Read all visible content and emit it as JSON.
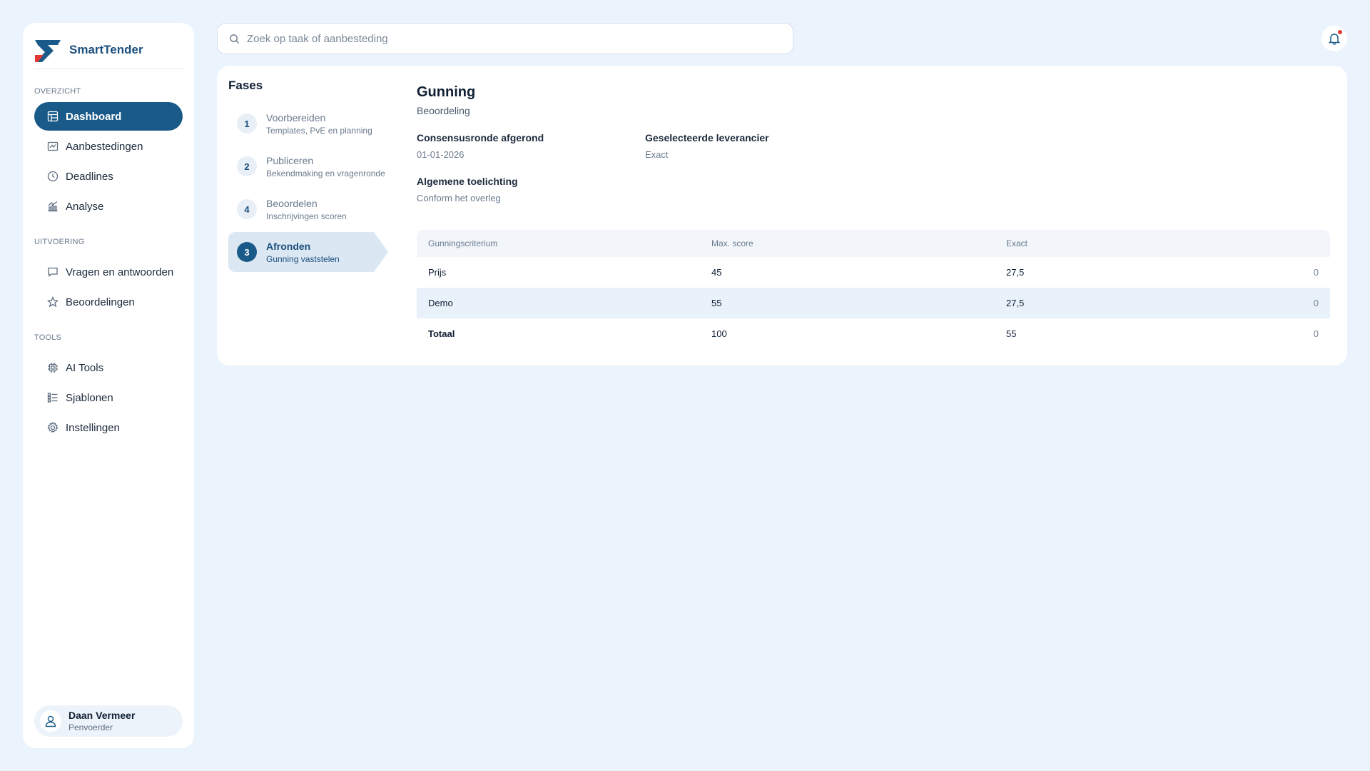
{
  "app": {
    "name": "SmartTender"
  },
  "sidebar": {
    "sections": [
      {
        "label": "OVERZICHT"
      },
      {
        "label": "UITVOERING"
      },
      {
        "label": "TOOLS"
      }
    ],
    "items": [
      {
        "label": "Dashboard",
        "icon": "dashboard-icon",
        "active": true
      },
      {
        "label": "Aanbestedingen",
        "icon": "tenders-icon"
      },
      {
        "label": "Deadlines",
        "icon": "clock-icon"
      },
      {
        "label": "Analyse",
        "icon": "chart-icon"
      },
      {
        "label": "Vragen en antwoorden",
        "icon": "chat-icon"
      },
      {
        "label": "Beoordelingen",
        "icon": "star-icon"
      },
      {
        "label": "AI Tools",
        "icon": "chip-icon"
      },
      {
        "label": "Sjablonen",
        "icon": "list-icon"
      },
      {
        "label": "Instellingen",
        "icon": "gear-icon"
      }
    ],
    "user": {
      "name": "Daan Vermeer",
      "role": "Penvoerder"
    }
  },
  "search": {
    "placeholder": "Zoek op taak of aanbesteding",
    "value": ""
  },
  "notifications": {
    "unread": true
  },
  "phases": {
    "title": "Fases",
    "items": [
      {
        "num": "1",
        "title": "Voorbereiden",
        "subtitle": "Templates, PvE en planning"
      },
      {
        "num": "2",
        "title": "Publiceren",
        "subtitle": "Bekendmaking en vragenronde"
      },
      {
        "num": "4",
        "title": "Beoordelen",
        "subtitle": "Inschrijvingen scoren"
      },
      {
        "num": "3",
        "title": "Afronden",
        "subtitle": "Gunning vaststelen",
        "active": true
      }
    ]
  },
  "detail": {
    "title": "Gunning",
    "subtitle": "Beoordeling",
    "fields": {
      "consensus_label": "Consensusronde afgerond",
      "consensus_value": "01-01-2026",
      "supplier_label": "Geselecteerde leverancier",
      "supplier_value": "Exact",
      "notes_label": "Algemene toelichting",
      "notes_value": "Conform het overleg"
    }
  },
  "table": {
    "headers": [
      "Gunningscriterium",
      "Max. score",
      "Exact",
      ""
    ],
    "rows": [
      [
        "Prijs",
        "45",
        "27,5",
        "0"
      ],
      [
        "Demo",
        "55",
        "27,5",
        "0"
      ],
      [
        "Totaal",
        "100",
        "55",
        "0"
      ]
    ]
  },
  "colors": {
    "primary": "#1a5a88",
    "background": "#ebf3fc",
    "accent_red": "#e53935"
  }
}
